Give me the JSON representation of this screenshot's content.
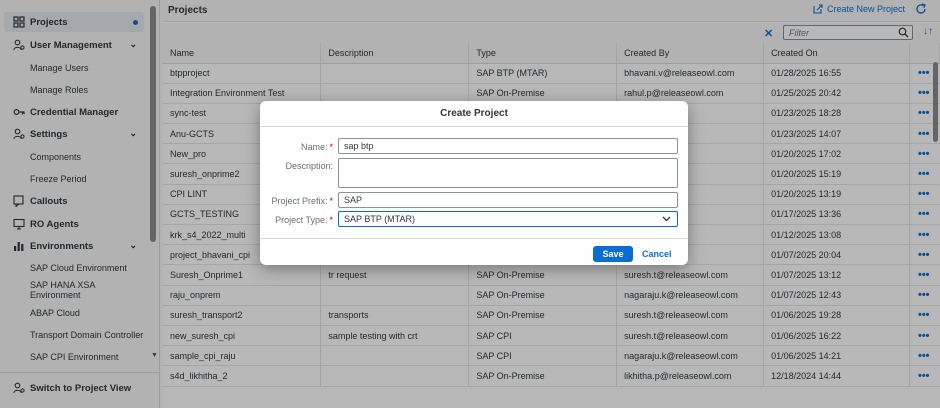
{
  "sidebar": {
    "projects": "Projects",
    "user_management": "User Management",
    "manage_users": "Manage Users",
    "manage_roles": "Manage Roles",
    "credential_manager": "Credential Manager",
    "settings": "Settings",
    "components": "Components",
    "freeze_period": "Freeze Period",
    "callouts": "Callouts",
    "ro_agents": "RO Agents",
    "environments": "Environments",
    "env_items": [
      "SAP Cloud Environment",
      "SAP HANA XSA Environment",
      "ABAP Cloud",
      "Transport Domain Controller",
      "SAP CPI Environment"
    ],
    "switch_view": "Switch to Project View"
  },
  "main": {
    "title": "Projects",
    "create_new": "Create New Project",
    "filter_placeholder": "Filter",
    "columns": [
      "Name",
      "Description",
      "Type",
      "Created By",
      "Created On"
    ],
    "rows": [
      [
        "btpproject",
        "",
        "SAP BTP (MTAR)",
        "bhavani.v@releaseowl.com",
        "01/28/2025 16:55"
      ],
      [
        "Integration Environment Test",
        "",
        "SAP On-Premise",
        "rahul.p@releaseowl.com",
        "01/25/2025 20:42"
      ],
      [
        "sync-test",
        "",
        "",
        "releaseowl.com",
        "01/23/2025 18:28"
      ],
      [
        "Anu-GCTS",
        "",
        "",
        "releaseowl.com",
        "01/23/2025 14:07"
      ],
      [
        "New_pro",
        "",
        "",
        "releaseowl.com",
        "01/20/2025 17:02"
      ],
      [
        "suresh_onprime2",
        "",
        "",
        "releaseowl.com",
        "01/20/2025 15:19"
      ],
      [
        "CPI LINT",
        "",
        "",
        "releaseowl.com",
        "01/20/2025 13:19"
      ],
      [
        "GCTS_TESTING",
        "",
        "",
        "releaseowl.com",
        "01/17/2025 13:36"
      ],
      [
        "krk_s4_2022_multi",
        "",
        "",
        "releaseowl.com",
        "01/12/2025 13:08"
      ],
      [
        "project_bhavani_cpi",
        "",
        "",
        "releaseowl.com",
        "01/07/2025 20:04"
      ],
      [
        "Suresh_Onprime1",
        "tr request",
        "SAP On-Premise",
        "suresh.t@releaseowl.com",
        "01/07/2025 13:12"
      ],
      [
        "raju_onprem",
        "",
        "SAP On-Premise",
        "nagaraju.k@releaseowl.com",
        "01/07/2025 12:43"
      ],
      [
        "suresh_transport2",
        "transports",
        "SAP On-Premise",
        "suresh.t@releaseowl.com",
        "01/06/2025 19:28"
      ],
      [
        "new_suresh_cpi",
        "sample testing with crt",
        "SAP CPI",
        "suresh.t@releaseowl.com",
        "01/06/2025 16:22"
      ],
      [
        "sample_cpi_raju",
        "",
        "SAP CPI",
        "nagaraju.k@releaseowl.com",
        "01/06/2025 14:21"
      ],
      [
        "s4d_likhitha_2",
        "",
        "SAP On-Premise",
        "likhitha.p@releaseowl.com",
        "12/18/2024 14:44"
      ]
    ],
    "row_action": "•••"
  },
  "dialog": {
    "title": "Create Project",
    "name_label": "Name:",
    "name_value": "sap btp",
    "description_label": "Description:",
    "description_value": "",
    "prefix_label": "Project Prefix:",
    "prefix_value": "SAP",
    "type_label": "Project Type:",
    "type_value": "SAP BTP (MTAR)",
    "required_mark": "*",
    "save": "Save",
    "cancel": "Cancel"
  },
  "colors": {
    "accent": "#0a6ed1",
    "required": "#bb0000",
    "sidebar_bg": "#f7f7f7",
    "overlay": "rgba(0,0,0,0.28)"
  }
}
